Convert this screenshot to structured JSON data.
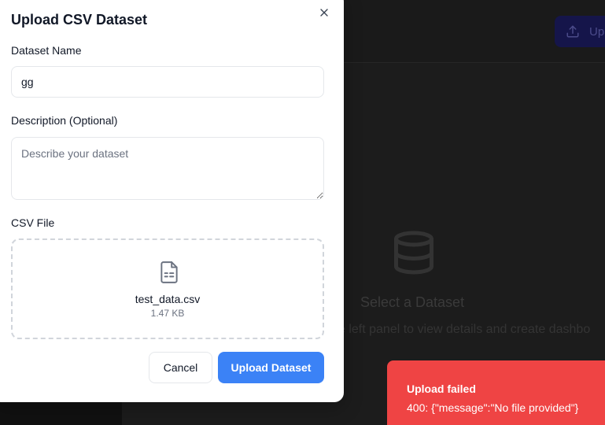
{
  "background": {
    "header_button_label": "Up",
    "empty_title": "Select a Dataset",
    "empty_subtitle": "e left panel to view details and create dashbo"
  },
  "modal": {
    "title": "Upload CSV Dataset",
    "name_label": "Dataset Name",
    "name_value": "gg",
    "description_label": "Description (Optional)",
    "description_placeholder": "Describe your dataset",
    "csv_label": "CSV File",
    "file_name": "test_data.csv",
    "file_size": "1.47 KB",
    "cancel_label": "Cancel",
    "submit_label": "Upload Dataset"
  },
  "toast": {
    "title": "Upload failed",
    "message": "400: {\"message\":\"No file provided\"}"
  },
  "colors": {
    "primary": "#3b82f6",
    "error": "#ef4444"
  },
  "icons": {
    "close": "close-icon",
    "file": "file-spreadsheet-icon",
    "upload": "upload-icon",
    "database": "database-icon"
  }
}
